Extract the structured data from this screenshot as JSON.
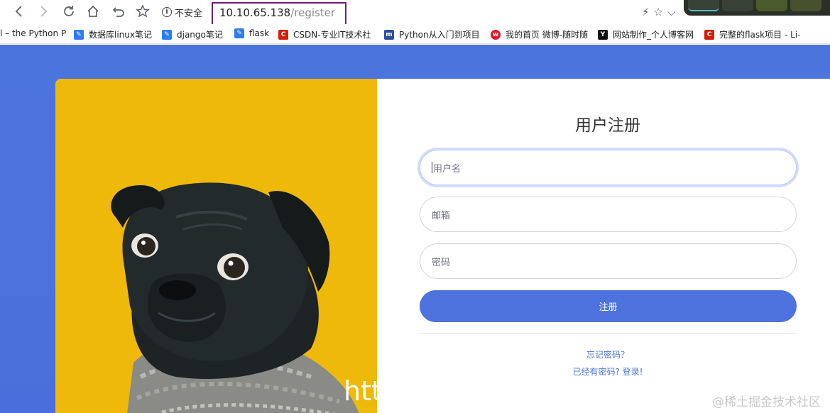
{
  "browser": {
    "security_label": "不安全",
    "url_host": "10.10.65.138",
    "url_path": "/register",
    "bookmarks": [
      {
        "label": "l – the Python P",
        "color": "#ffffff"
      },
      {
        "label": "数据库linux笔记",
        "color": "#2f7bf6"
      },
      {
        "label": "django笔记",
        "color": "#2f7bf6"
      },
      {
        "label": "flask",
        "color": "#2f7bf6"
      },
      {
        "label": "CSDN-专业IT技术社",
        "color": "#d81e06"
      },
      {
        "label": "Python从入门到项目",
        "color": "#2a4ea7"
      },
      {
        "label": "我的首页 微博-随时随",
        "color": "#e6162d"
      },
      {
        "label": "网站制作_个人博客网",
        "color": "#111111"
      },
      {
        "label": "完整的flask项目 - Li-",
        "color": "#d81e06"
      }
    ]
  },
  "register": {
    "title": "用户注册",
    "username_placeholder": "用户名",
    "email_placeholder": "邮箱",
    "password_placeholder": "密码",
    "submit_label": "注册",
    "forgot_link": "忘记密码？",
    "login_link": "已经有密码? 登录!"
  },
  "photo": {
    "overlay_text": "htt"
  },
  "watermark": "@稀土掘金技术社区",
  "colors": {
    "primary": "#4e73df",
    "photo_bg": "#efb90b",
    "url_highlight": "#6d1f78"
  }
}
